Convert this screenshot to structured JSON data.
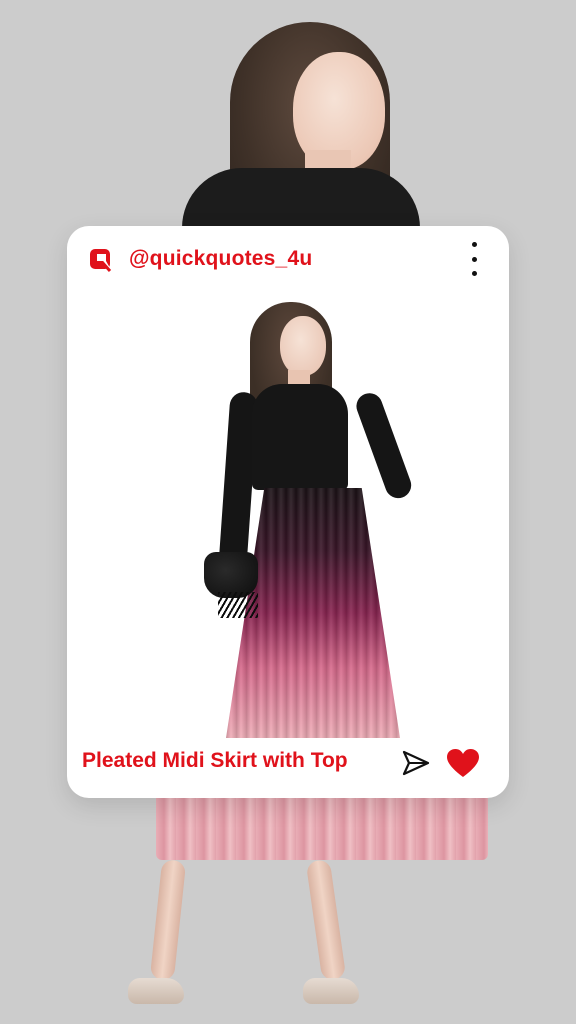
{
  "post": {
    "username": "@quickquotes_4u",
    "caption": "Pleated Midi Skirt with Top"
  },
  "icons": {
    "logo": "quickquotes-logo-icon",
    "more": "more-vertical-icon",
    "share": "send-icon",
    "like": "heart-icon"
  },
  "colors": {
    "accent": "#e0121b",
    "background": "#cccccc",
    "card": "#ffffff"
  }
}
